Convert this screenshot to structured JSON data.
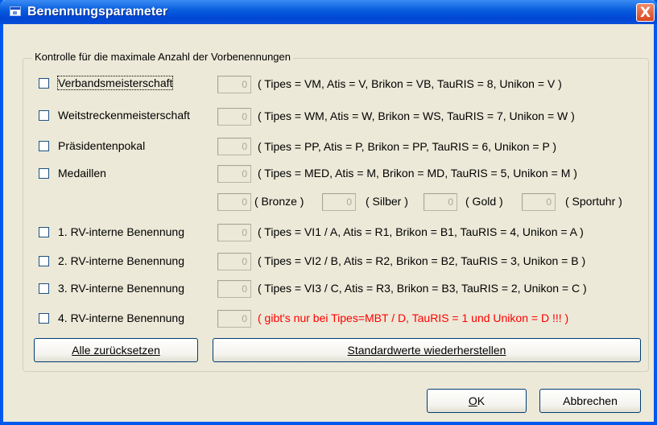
{
  "window": {
    "title": "Benennungsparameter",
    "close_symbol": "X"
  },
  "group": {
    "legend": "Kontrolle für die maximale Anzahl der Vorbenennungen"
  },
  "rows": [
    {
      "label": "Verbandsmeisterschaft",
      "checked": false,
      "value": "0",
      "info": "( Tipes = VM, Atis = V, Brikon = VB, TauRIS = 8, Unikon = V )"
    },
    {
      "label": "Weitstreckenmeisterschaft",
      "checked": false,
      "value": "0",
      "info": "( Tipes = WM, Atis = W, Brikon = WS, TauRIS = 7, Unikon = W )"
    },
    {
      "label": "Präsidentenpokal",
      "checked": false,
      "value": "0",
      "info": "( Tipes = PP, Atis = P, Brikon = PP, TauRIS = 6, Unikon = P )"
    },
    {
      "label": "Medaillen",
      "checked": false,
      "value": "0",
      "info": "( Tipes = MED, Atis = M, Brikon = MD, TauRIS = 5, Unikon = M )"
    }
  ],
  "medals": [
    {
      "value": "0",
      "label": "( Bronze )"
    },
    {
      "value": "0",
      "label": "( Silber )"
    },
    {
      "value": "0",
      "label": "( Gold )"
    },
    {
      "value": "0",
      "label": "( Sportuhr )"
    }
  ],
  "rv_rows": [
    {
      "label": "1. RV-interne Benennung",
      "checked": false,
      "value": "0",
      "info": "( Tipes = VI1 / A, Atis = R1, Brikon = B1, TauRIS = 4, Unikon = A )"
    },
    {
      "label": "2. RV-interne Benennung",
      "checked": false,
      "value": "0",
      "info": "( Tipes = VI2 / B, Atis = R2, Brikon = B2, TauRIS = 3, Unikon = B )"
    },
    {
      "label": "3. RV-interne Benennung",
      "checked": false,
      "value": "0",
      "info": "( Tipes = VI3 / C, Atis = R3, Brikon = B3, TauRIS = 2, Unikon = C )"
    },
    {
      "label": "4. RV-interne Benennung",
      "checked": false,
      "value": "0",
      "info": "( gibt's nur bei Tipes=MBT / D, TauRIS = 1 und Unikon = D !!! )"
    }
  ],
  "buttons": {
    "reset": "Alle zurücksetzen",
    "defaults": "Standardwerte wiederherstellen",
    "ok_mnemonic": "O",
    "ok_rest": "K",
    "cancel": "Abbrechen"
  },
  "colors": {
    "title_bar": "#0058ee",
    "dialog_bg": "#ece9d8",
    "warning_text": "#ff0000"
  }
}
